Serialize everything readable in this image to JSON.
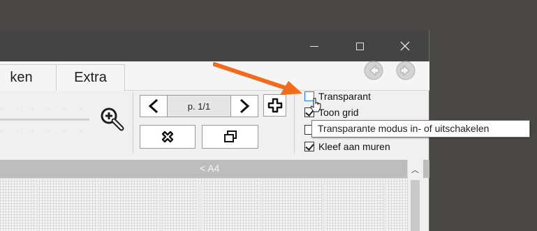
{
  "window": {
    "controls": {
      "minimize": "minimize",
      "maximize": "maximize",
      "close": "close"
    }
  },
  "tabs": [
    {
      "label": "ken"
    },
    {
      "label": "Extra"
    }
  ],
  "page_nav": {
    "label": "p. 1/1"
  },
  "options": {
    "transparent": {
      "label": "Transparant",
      "checked": false
    },
    "show_grid": {
      "label": "Toon grid",
      "checked": true
    },
    "stick_walls": {
      "label": "Kleef aan muren",
      "checked": true
    }
  },
  "tooltip": {
    "text": "Transparante modus in- of uitschakelen"
  },
  "sheet": {
    "label": "< A4"
  },
  "colors": {
    "titlebar": "#444444",
    "accent_arrow": "#f26a1b",
    "checkbox_focus": "#1a7ee0"
  }
}
